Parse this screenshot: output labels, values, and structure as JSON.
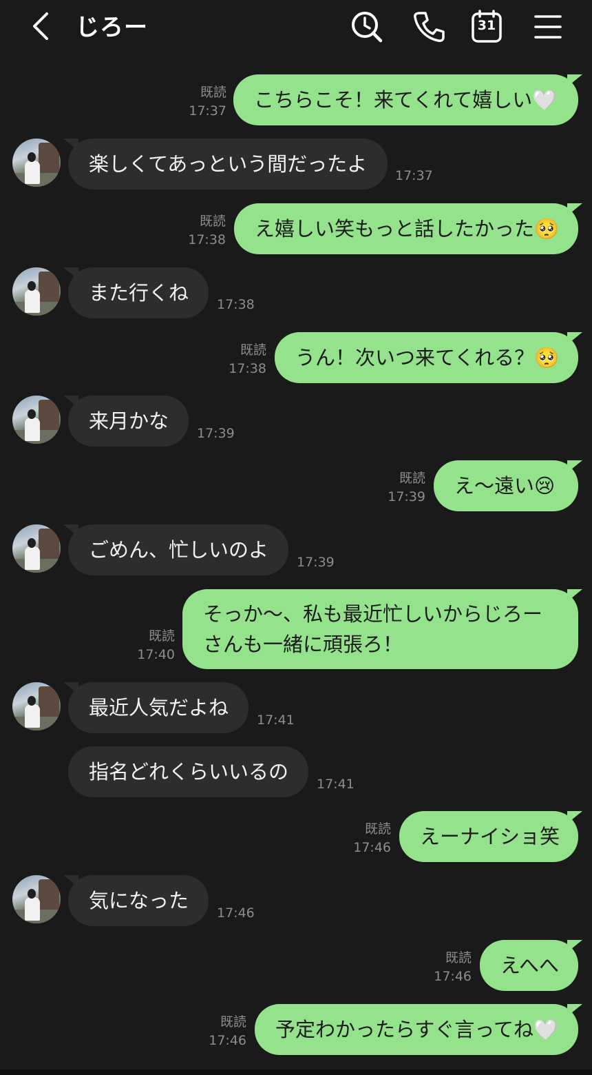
{
  "header": {
    "title": "じろー",
    "calendar_day": "31",
    "icons": [
      "back-icon",
      "search-icon",
      "phone-icon",
      "calendar-icon",
      "menu-icon"
    ]
  },
  "read_label": "既読",
  "messages": [
    {
      "dir": "out",
      "text": "こちらこそ！来てくれて嬉しい🤍",
      "time": "17:37",
      "read": "既読"
    },
    {
      "dir": "in",
      "text": "楽しくてあっという間だったよ",
      "time": "17:37"
    },
    {
      "dir": "out",
      "text": "え嬉しい笑もっと話したかった🥺",
      "time": "17:38",
      "read": "既読"
    },
    {
      "dir": "in",
      "text": "また行くね",
      "time": "17:38"
    },
    {
      "dir": "out",
      "text": "うん！次いつ来てくれる？🥺",
      "time": "17:38",
      "read": "既読"
    },
    {
      "dir": "in",
      "text": "来月かな",
      "time": "17:39"
    },
    {
      "dir": "out",
      "text": "え〜遠い😢",
      "time": "17:39",
      "read": "既読"
    },
    {
      "dir": "in",
      "text": "ごめん、忙しいのよ",
      "time": "17:39"
    },
    {
      "dir": "out",
      "text": "そっか〜、私も最近忙しいからじろーさんも一緒に頑張ろ！",
      "time": "17:40",
      "read": "既読"
    },
    {
      "dir": "in",
      "text": "最近人気だよね",
      "time": "17:41"
    },
    {
      "dir": "in",
      "text": "指名どれくらいいるの",
      "time": "17:41"
    },
    {
      "dir": "out",
      "text": "えーナイショ笑",
      "time": "17:46",
      "read": "既読"
    },
    {
      "dir": "in",
      "text": "気になった",
      "time": "17:46"
    },
    {
      "dir": "out",
      "text": "えへへ",
      "time": "17:46",
      "read": "既読"
    },
    {
      "dir": "out",
      "text": "予定わかったらすぐ言ってね🤍",
      "time": "17:46",
      "read": "既読"
    }
  ],
  "colors": {
    "background": "#1a1a1a",
    "outgoing_bubble": "#95e28c",
    "incoming_bubble": "#2d2d2d",
    "meta_text": "#8d8d8d"
  }
}
